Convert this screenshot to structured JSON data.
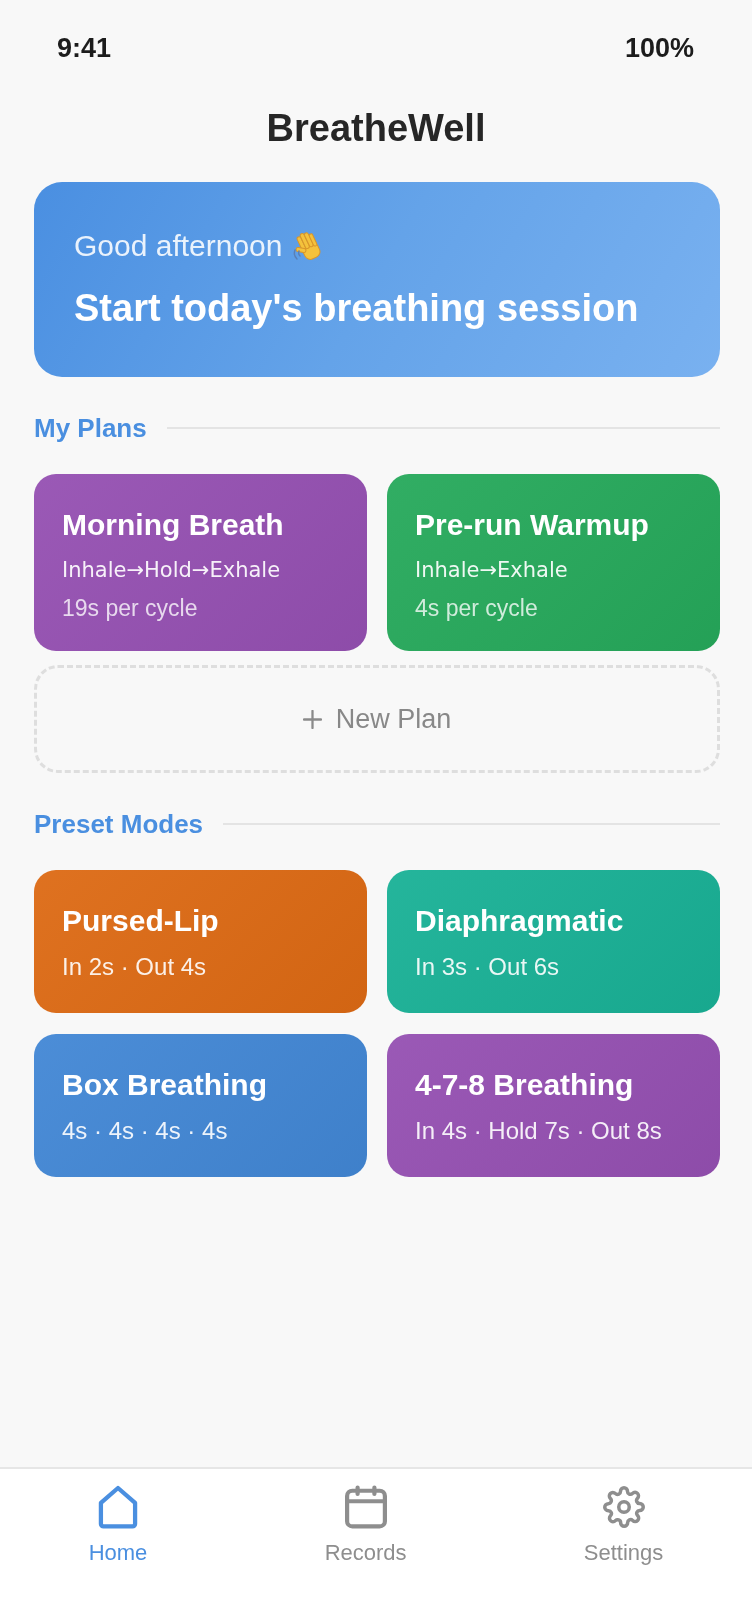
{
  "status_bar": {
    "time": "9:41",
    "battery": "100%"
  },
  "header": {
    "title": "BreatheWell"
  },
  "hero": {
    "greeting": "Good afternoon",
    "title": "Start today's breathing session"
  },
  "my_plans": {
    "heading": "My Plans",
    "plans": [
      {
        "name": "Morning Breath",
        "pattern": "Inhale→Hold→Exhale",
        "cycle": "19s per cycle",
        "color": "#9550b2"
      },
      {
        "name": "Pre-run Warmup",
        "pattern": "Inhale→Exhale",
        "cycle": "4s per cycle",
        "color": "#26a95b"
      }
    ],
    "new_plan_button": {
      "label": "New Plan"
    }
  },
  "preset_modes": {
    "heading": "Preset Modes",
    "modes": [
      {
        "name": "Pursed-Lip",
        "timing": "In 2s · Out 4s",
        "color": "#dd6a14"
      },
      {
        "name": "Diaphragmatic",
        "timing": "In 3s · Out 6s",
        "color": "#19b196"
      },
      {
        "name": "Box Breathing",
        "timing": "4s · 4s · 4s · 4s",
        "color": "#4287d5"
      },
      {
        "name": "4-7-8 Breathing",
        "timing": "In 4s · Hold 7s · Out 8s",
        "color": "#9550b2"
      }
    ]
  },
  "tab_bar": [
    {
      "label": "Home",
      "selected": true
    },
    {
      "label": "Records",
      "selected": false
    },
    {
      "label": "Settings",
      "selected": false
    }
  ]
}
